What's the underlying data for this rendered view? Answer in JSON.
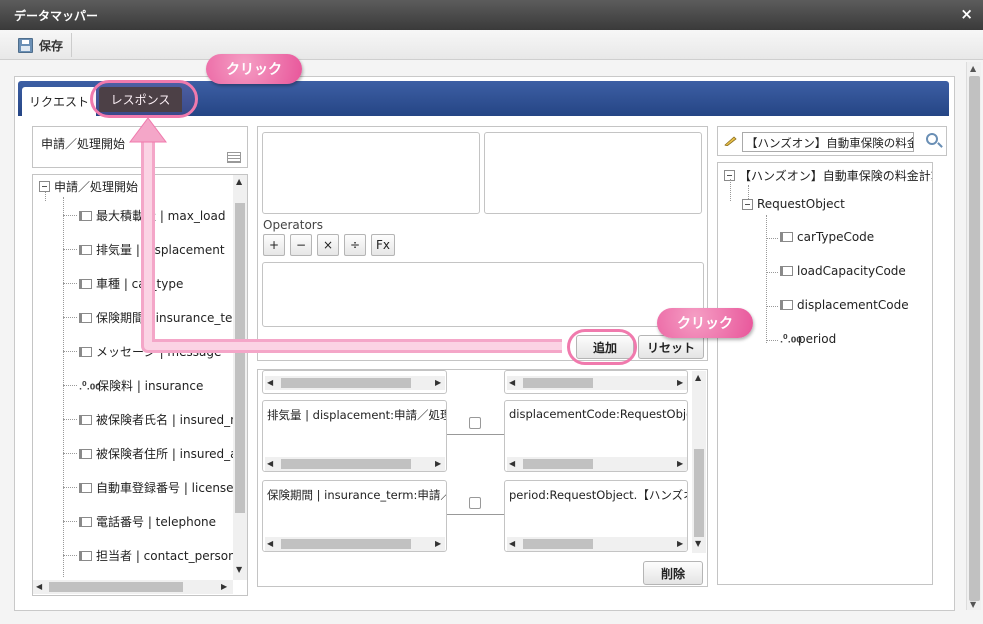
{
  "window": {
    "title": "データマッパー",
    "close_icon": "×"
  },
  "toolbar": {
    "save_label": "保存"
  },
  "tabs": [
    {
      "label": "リクエスト"
    },
    {
      "label": "レスポンス"
    }
  ],
  "left": {
    "header": "申請／処理開始",
    "root": "申請／処理開始",
    "items": [
      {
        "label": "最大積載量 | max_load",
        "type": "field"
      },
      {
        "label": "排気量 | displacement",
        "type": "field"
      },
      {
        "label": "車種 | car_type",
        "type": "field"
      },
      {
        "label": "保険期間 | insurance_term",
        "type": "field"
      },
      {
        "label": "メッセージ | message",
        "type": "field"
      },
      {
        "label": "保険料 | insurance",
        "type": "number"
      },
      {
        "label": "被保険者氏名 | insured_name",
        "type": "field"
      },
      {
        "label": "被保険者住所 | insured_address",
        "type": "field"
      },
      {
        "label": "自動車登録番号 | license_number",
        "type": "field"
      },
      {
        "label": "電話番号 | telephone",
        "type": "field"
      },
      {
        "label": "担当者 | contact_personnel",
        "type": "field"
      }
    ]
  },
  "middle": {
    "operators_label": "Operators",
    "operators": [
      "+",
      "−",
      "×",
      "÷",
      "Fx"
    ],
    "add_label": "追加",
    "reset_label": "リセット",
    "delete_label": "削除",
    "mappings": [
      {
        "source": "排気量 | displacement:申請／処理開始",
        "target": "displacementCode:RequestObject"
      },
      {
        "source": "保険期間 | insurance_term:申請／処理開始",
        "target": "period:RequestObject.【ハンズオン】自動車保険の料金計算"
      }
    ]
  },
  "right": {
    "search_value": "【ハンズオン】自動車保険の料金計算",
    "root": "【ハンズオン】自動車保険の料金計算",
    "object": "RequestObject",
    "items": [
      {
        "label": "carTypeCode",
        "type": "field"
      },
      {
        "label": "loadCapacityCode",
        "type": "field"
      },
      {
        "label": "displacementCode",
        "type": "field"
      },
      {
        "label": "period",
        "type": "number"
      }
    ]
  },
  "callouts": {
    "tab": "クリック",
    "add": "クリック"
  },
  "colors": {
    "accent": "#2d4f95",
    "callout": "#e8559a",
    "highlight": "#f07aad"
  }
}
